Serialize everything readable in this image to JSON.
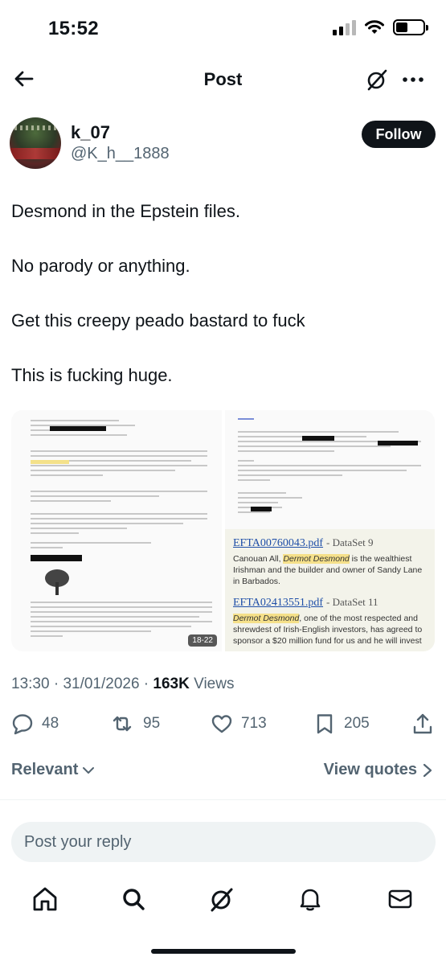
{
  "status_bar": {
    "time": "15:52",
    "battery_level": 0.45
  },
  "nav": {
    "title": "Post"
  },
  "author": {
    "display_name": "k_07",
    "handle": "@K_h__1888",
    "follow_label": "Follow"
  },
  "post": {
    "paragraphs": [
      "Desmond in the Epstein files.",
      "No parody or anything.",
      "Get this creepy peado bastard to fuck",
      "This is fucking huge."
    ],
    "media": {
      "badge": "18-22",
      "results": [
        {
          "file": "EFTA00760043.pdf",
          "dataset": "- DataSet 9",
          "pre": "Canouan All, ",
          "highlight": "Dermot Desmond",
          "post": " is the wealthiest Irishman and the builder and owner of Sandy Lane in Barbados."
        },
        {
          "file": "EFTA02413551.pdf",
          "dataset": "- DataSet 11",
          "pre": "",
          "highlight": "Dermot Desmond",
          "post": ", one of the most respected and shrewdest of Irish-English investors, has agreed to sponsor a $20 million fund for us and he will invest"
        }
      ]
    }
  },
  "meta": {
    "time": "13:30",
    "date": "31/01/2026",
    "views": "163K",
    "views_label": "Views"
  },
  "actions": {
    "replies": "48",
    "reposts": "95",
    "likes": "713",
    "bookmarks": "205"
  },
  "replies_header": {
    "sort_label": "Relevant",
    "quotes_label": "View quotes"
  },
  "reply_box": {
    "placeholder": "Post your reply"
  }
}
